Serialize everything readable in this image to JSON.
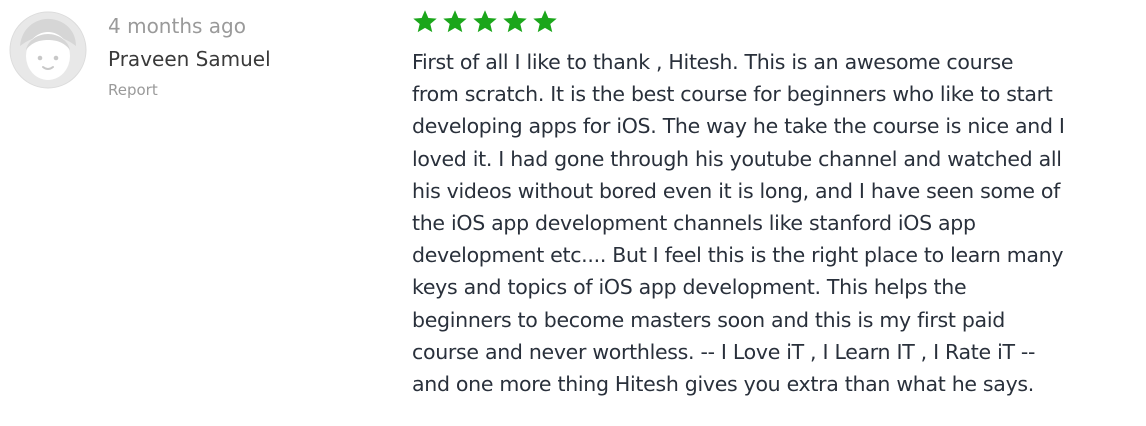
{
  "review": {
    "time_ago": "4 months ago",
    "reviewer_name": "Praveen Samuel",
    "report_label": "Report",
    "rating": 5,
    "rating_max": 5,
    "star_color": "#1ba61b",
    "avatar_bg": "#e8e8e8",
    "text_lines": [
      "First of all I like to thank , Hitesh. This is an awesome course",
      "from scratch. It is the best course for beginners who like to start",
      "developing apps for iOS. The way he take the course is nice and I",
      "loved it. I had gone through his youtube channel and watched all",
      "his videos without bored even it is long, and I have seen some of",
      "the iOS app development channels like stanford iOS app",
      "development etc.... But I feel this is the right place to learn many",
      "keys and topics of iOS app development. This helps the",
      "beginners to become masters soon and this is my first paid",
      "course and never worthless. -- I Love iT , I Learn IT , I Rate iT --",
      "and one more thing Hitesh gives you extra than what he says."
    ]
  }
}
